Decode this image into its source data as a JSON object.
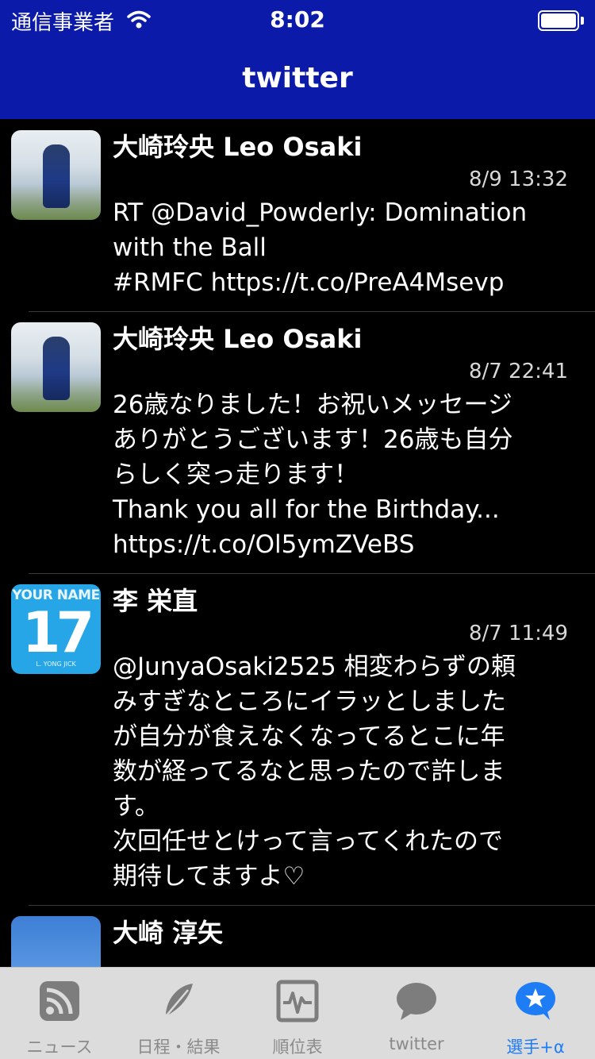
{
  "status_bar": {
    "carrier": "通信事業者",
    "time": "8:02"
  },
  "nav": {
    "title": "twitter"
  },
  "tweets": [
    {
      "name": "大崎玲央 Leo Osaki",
      "time": "8/9 13:32",
      "text": "RT @David_Powderly: Domination\nwith the Ball\n#RMFC https://t.co/PreA4Msevp",
      "avatar": "player-photo"
    },
    {
      "name": "大崎玲央 Leo Osaki",
      "time": "8/7 22:41",
      "text": "26歳なりました！お祝いメッセージ\nありがとうございます！26歳も自分\nらしく突っ走ります！\nThank you all for the Birthday...\nhttps://t.co/Ol5ymZVeBS",
      "avatar": "player-photo"
    },
    {
      "name": "李 栄直",
      "time": "8/7 11:49",
      "text": "@JunyaOsaki2525 相変わらずの頼\nみすぎなところにイラッとしました\nが自分が食えなくなってるとこに年\n数が経ってるなと思ったので許しま\nす。\n次回任せとけって言ってくれたので\n期待してますよ♡",
      "avatar": "jersey",
      "avatar_text": {
        "top": "YOUR NAME",
        "number": "17",
        "sub": "L. YONG JICK"
      }
    },
    {
      "name": "大崎 淳矢",
      "time": "",
      "text": "",
      "avatar": "blue-photo"
    }
  ],
  "tab_bar": {
    "items": [
      {
        "label": "ニュース",
        "icon": "rss-icon"
      },
      {
        "label": "日程・結果",
        "icon": "feather-icon"
      },
      {
        "label": "順位表",
        "icon": "chart-icon"
      },
      {
        "label": "twitter",
        "icon": "chat-bubble-icon"
      },
      {
        "label": "選手+α",
        "icon": "star-bubble-icon",
        "active": true
      }
    ]
  },
  "colors": {
    "header": "#0b1aa9",
    "background": "#000000",
    "tab_active": "#1e7cf5",
    "tab_inactive": "#8a8a8a",
    "tab_bar": "#dcdcdc"
  }
}
